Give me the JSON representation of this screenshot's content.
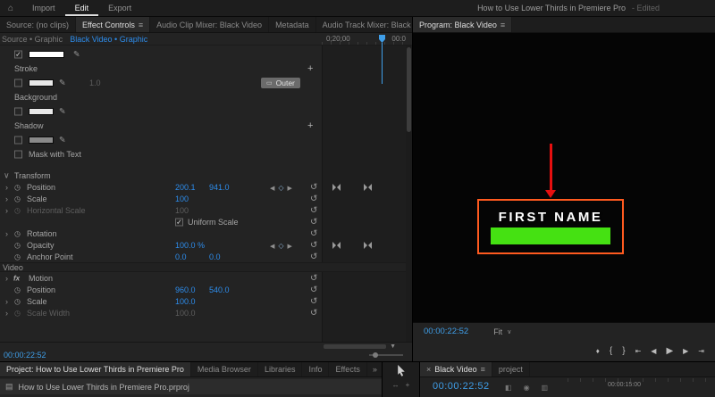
{
  "colors": {
    "value_blue": "#2d8ceb",
    "timecode_blue": "#3f9ee8",
    "green_bar": "#45e112",
    "selection_orange": "#ff5a1f",
    "arrow_red": "#e60f0f"
  },
  "icons": {
    "home": "⌂",
    "menu": "≡",
    "close": "×",
    "overflow": "»",
    "plus": "+",
    "eyedropper": "✎",
    "stopwatch": "◷",
    "twirl_closed": "›",
    "twirl_open": "∨",
    "reset": "↺",
    "kf_prev": "◀",
    "kf_add": "◇",
    "kf_next": "▶",
    "chevron": "∨",
    "fx": "fx",
    "filter": "▼",
    "stroke_style": "▭",
    "marker": "♦",
    "mark_in": "{",
    "mark_out": "}",
    "go_to_in": "⇤",
    "step_back": "◀",
    "play": "▶",
    "step_forward": "▶",
    "go_to_out": "⇥",
    "file": "▤",
    "track_select": "↔",
    "tool_plus": "+",
    "grid1": "◧",
    "grid2": "◉",
    "grid3": "▥"
  },
  "header": {
    "tabs": [
      "Import",
      "Edit",
      "Export"
    ],
    "title": "How to Use Lower Thirds in Premiere Pro",
    "edited": "- Edited"
  },
  "effect_controls": {
    "source_tab": "Source: (no clips)",
    "tab": "Effect Controls",
    "tab_audio_clip": "Audio Clip Mixer: Black Video",
    "tab_metadata": "Metadata",
    "tab_audio_track": "Audio Track Mixer: Black Video",
    "breadcrumb_source": "Source • Graphic",
    "breadcrumb_clip": "Black Video • Graphic",
    "ruler_start": "0;20;00",
    "ruler_end": "00:0",
    "stroke": {
      "label": "Stroke",
      "width": "1.0",
      "type": "Outer"
    },
    "background": {
      "label": "Background"
    },
    "shadow": {
      "label": "Shadow"
    },
    "mask": {
      "label": "Mask with Text"
    },
    "transform": {
      "label": "Transform",
      "position_label": "Position",
      "position_x": "200.1",
      "position_y": "941.0",
      "scale_label": "Scale",
      "scale": "100",
      "hscale_label": "Horizontal Scale",
      "hscale": "100",
      "uniform_label": "Uniform Scale",
      "rotation_label": "Rotation",
      "opacity_label": "Opacity",
      "opacity": "100.0 %",
      "anchor_label": "Anchor Point",
      "anchor_x": "0.0",
      "anchor_y": "0.0"
    },
    "video_section": "Video",
    "motion": {
      "label": "Motion",
      "position_label": "Position",
      "position_x": "960.0",
      "position_y": "540.0",
      "scale_label": "Scale",
      "scale": "100.0",
      "scale_width_label": "Scale Width",
      "scale_width": "100.0"
    },
    "timecode": "00:00:22:52"
  },
  "program": {
    "tab": "Program: Black Video",
    "overlay_text": "FIRST NAME",
    "timecode": "00:00:22:52",
    "zoom_level": "Fit"
  },
  "project": {
    "tab": "Project: How to Use Lower Thirds in Premiere Pro",
    "tab_media": "Media Browser",
    "tab_libraries": "Libraries",
    "tab_info": "Info",
    "tab_effects": "Effects",
    "item": "How to Use Lower Thirds in Premiere Pro.prproj"
  },
  "timeline": {
    "tab": "Black Video",
    "tab_project": "project",
    "timecode": "00:00:22:52",
    "ruler_label": "00:00:15:00"
  }
}
